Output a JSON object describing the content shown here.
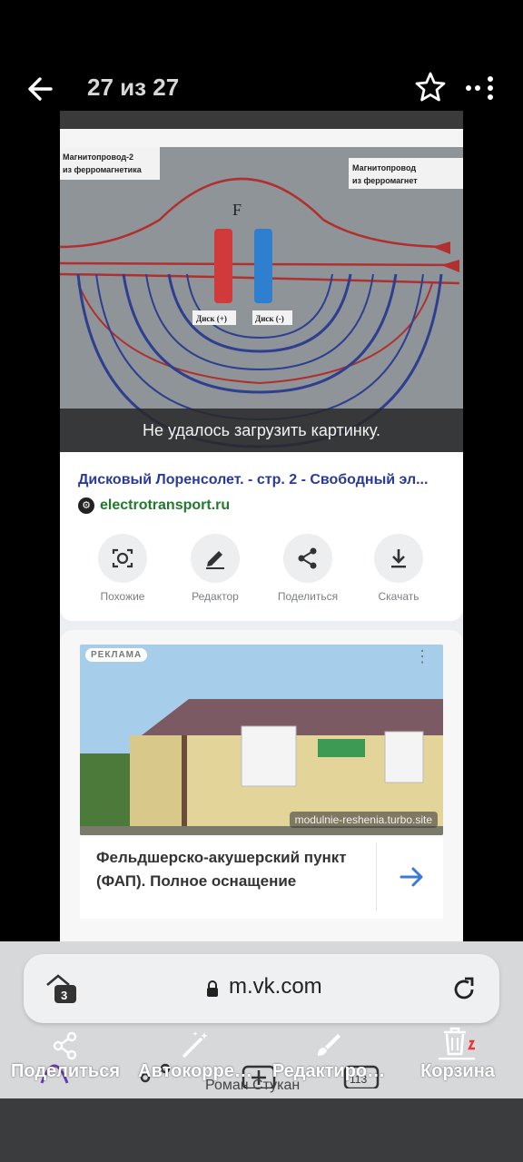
{
  "viewer": {
    "counter": "27 из 27",
    "icons": {
      "back": "arrow-left-icon",
      "favorite": "star-outline-icon",
      "more": "more-dots-icon"
    }
  },
  "image_result": {
    "labels": {
      "left_core": "Магнитопровод-2\nиз ферромагнетика",
      "right_core": "Магнитопровод\nиз ферромагнет",
      "force": "F",
      "disk_plus": "Диск (+)",
      "disk_minus": "Диск (-)"
    },
    "error_banner": "Не удалось загрузить картинку.",
    "title": "Дисковый Лоренсолет. - стр. 2 - Свободный эл...",
    "site": "electrotransport.ru",
    "actions": [
      {
        "label": "Похожие",
        "icon": "lens-search-icon"
      },
      {
        "label": "Редактор",
        "icon": "pencil-icon"
      },
      {
        "label": "Поделиться",
        "icon": "share-icon"
      },
      {
        "label": "Скачать",
        "icon": "download-icon"
      }
    ]
  },
  "ad": {
    "tag": "РЕКЛАМА",
    "url": "modulnie-reshenia.turbo.site",
    "title": "Фельдшерско-акушерский пункт (ФАП). Полное оснащение"
  },
  "browser": {
    "tab_count": "3",
    "url": "m.vk.com"
  },
  "gallery_toolbar": {
    "items": [
      {
        "label": "Поделиться",
        "icon": "share-icon"
      },
      {
        "label": "Автокорре…",
        "icon": "magic-wand-icon"
      },
      {
        "label": "Редактиро…",
        "icon": "brush-icon"
      },
      {
        "label": "Корзина",
        "icon": "trash-icon"
      }
    ],
    "background_count": "113",
    "background_name": "Роман Стукан"
  },
  "colors": {
    "link_title": "#2a3a9c",
    "site_green": "#1f7a2c",
    "ad_arrow": "#3a7bd5"
  }
}
